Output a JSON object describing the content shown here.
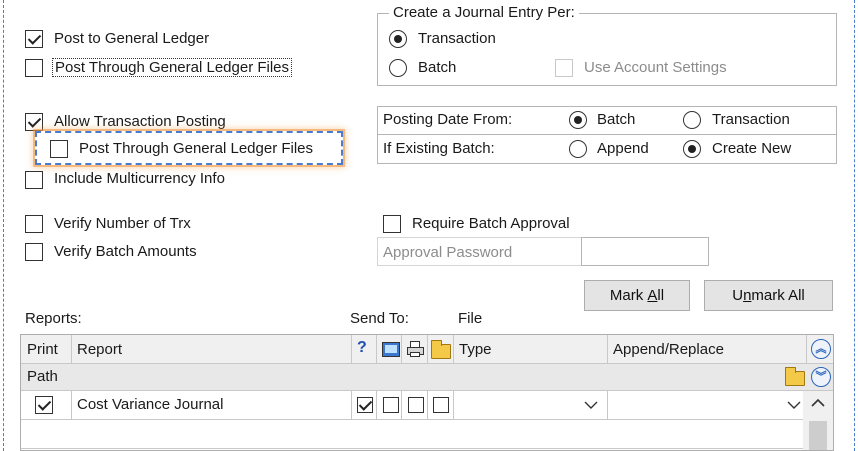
{
  "ledger": {
    "post_to_gl": "Post to General Ledger",
    "post_through_gl_files": "Post Through General Ledger Files"
  },
  "journal_entry": {
    "legend": "Create a Journal Entry Per:",
    "option_transaction": "Transaction",
    "option_batch": "Batch",
    "use_account_settings": "Use Account Settings"
  },
  "posting": {
    "allow_transaction_posting": "Allow Transaction Posting",
    "post_through_gl_files": "Post Through General Ledger Files",
    "include_multicurrency": "Include Multicurrency Info"
  },
  "posting_date": {
    "label": "Posting Date From:",
    "opt_batch": "Batch",
    "opt_transaction": "Transaction",
    "existing_label": "If Existing Batch:",
    "opt_append": "Append",
    "opt_create_new": "Create New"
  },
  "verify": {
    "number_of_trx": "Verify Number of Trx",
    "batch_amounts": "Verify Batch Amounts"
  },
  "approval": {
    "require_batch_approval": "Require Batch Approval",
    "approval_password_label": "Approval Password",
    "approval_password_value": ""
  },
  "buttons": {
    "mark_all_prefix": "Mark ",
    "mark_all_ul": "A",
    "mark_all_suffix": "ll",
    "unmark_all_prefix": "U",
    "unmark_all_ul": "n",
    "unmark_all_suffix": "mark All"
  },
  "reports": {
    "label": "Reports:",
    "send_to": "Send To:",
    "file": "File",
    "headers": {
      "print": "Print",
      "report": "Report",
      "help": "?",
      "type": "Type",
      "append_replace": "Append/Replace",
      "path": "Path"
    },
    "rows": [
      {
        "print": true,
        "report": "Cost Variance Journal",
        "help_checked": true,
        "type": "",
        "append_replace": ""
      }
    ]
  },
  "icons": {
    "screen": "screen-icon",
    "printer": "printer-icon",
    "folder": "folder-icon",
    "expand_up": "expand-up-icon",
    "expand_down": "expand-down-icon",
    "dropdown": "chevron-down-icon",
    "scroll_up": "chevron-up-icon"
  },
  "colors": {
    "highlight_border": "#4a7bd0",
    "highlight_glow": "#f0963c",
    "accent_blue": "#2a64b8"
  }
}
